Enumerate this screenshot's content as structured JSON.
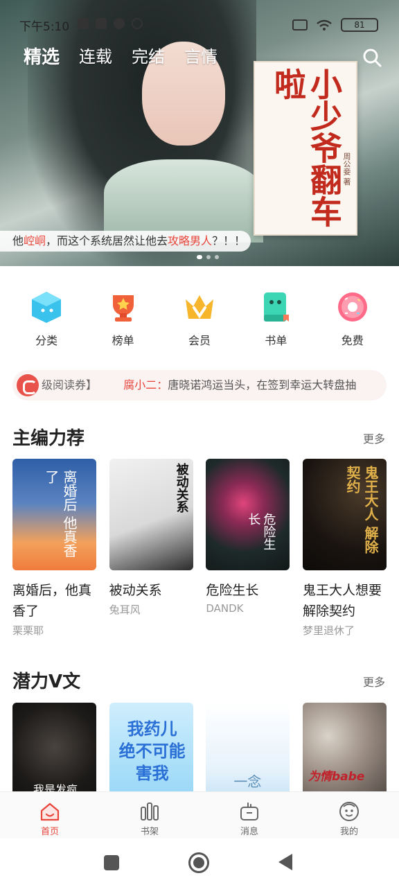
{
  "status_bar": {
    "time": "下午5:10",
    "battery": "81"
  },
  "top_tabs": [
    {
      "label": "精选",
      "active": true
    },
    {
      "label": "连载",
      "active": false
    },
    {
      "label": "完结",
      "active": false
    },
    {
      "label": "言情",
      "active": false
    }
  ],
  "banner": {
    "cover_title": "小少爷翻车啦",
    "cover_author": "周公妾 著",
    "caption_parts": [
      "他",
      "崆峒",
      "，而这个系统居然让他去",
      "攻略男人",
      "？！！"
    ]
  },
  "quick_entries": [
    {
      "label": "分类",
      "icon": "category-icon"
    },
    {
      "label": "榜单",
      "icon": "trophy-icon"
    },
    {
      "label": "会员",
      "icon": "crown-icon"
    },
    {
      "label": "书单",
      "icon": "booklist-icon"
    },
    {
      "label": "免费",
      "icon": "donut-icon"
    }
  ],
  "notice": {
    "prefix": "级阅读券】",
    "name": "腐小二：",
    "message": "唐晓诺鸿运当头，在签到幸运大转盘抽"
  },
  "sections": [
    {
      "title": "主编力荐",
      "more": "更多",
      "books": [
        {
          "title": "离婚后，他真香了",
          "author": "栗栗耶",
          "cover_text": "离婚后 他真香了"
        },
        {
          "title": "被动关系",
          "author": "兔耳风",
          "cover_text": "被动关系"
        },
        {
          "title": "危险生长",
          "author": "DANDK",
          "cover_text": "危险生长"
        },
        {
          "title": "鬼王大人想要解除契约",
          "author": "梦里退休了",
          "cover_text": "鬼王大人 解除契约"
        }
      ]
    },
    {
      "title": "潜力V文",
      "more": "更多",
      "books": [
        {
          "cover_text": "我是发疯"
        },
        {
          "cover_text": "我药儿 绝不可能害我"
        },
        {
          "cover_text": "一念"
        },
        {
          "cover_text": "为情babe"
        }
      ]
    }
  ],
  "bottom_tabs": [
    {
      "label": "首页",
      "icon": "home-icon",
      "active": true
    },
    {
      "label": "书架",
      "icon": "bookshelf-icon",
      "active": false
    },
    {
      "label": "消息",
      "icon": "message-icon",
      "active": false
    },
    {
      "label": "我的",
      "icon": "profile-icon",
      "active": false
    }
  ],
  "colors": {
    "accent": "#e8443a",
    "notice_bg": "#fbf2f2"
  }
}
